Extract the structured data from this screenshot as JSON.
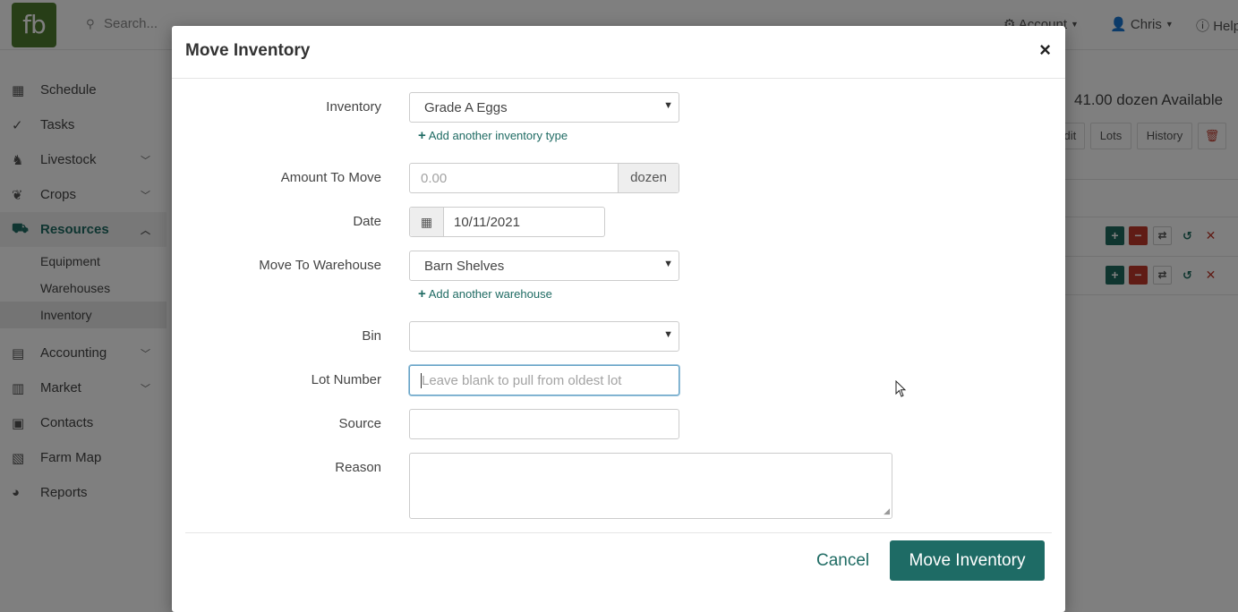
{
  "app": {
    "logo_text": "fb",
    "search_placeholder": "Search...",
    "account_label": "Account",
    "user_label": "Chris",
    "help_label": "Help"
  },
  "sidebar": {
    "items": [
      {
        "label": "Schedule",
        "icon": "calendar-icon"
      },
      {
        "label": "Tasks",
        "icon": "check-circle-icon"
      },
      {
        "label": "Livestock",
        "icon": "horse-icon"
      },
      {
        "label": "Crops",
        "icon": "seedling-icon"
      },
      {
        "label": "Resources",
        "icon": "tractor-icon"
      },
      {
        "label": "Accounting",
        "icon": "calculator-icon"
      },
      {
        "label": "Market",
        "icon": "store-icon"
      },
      {
        "label": "Contacts",
        "icon": "address-book-icon"
      },
      {
        "label": "Farm Map",
        "icon": "map-icon"
      },
      {
        "label": "Reports",
        "icon": "pie-chart-icon"
      }
    ],
    "resources_sub": [
      "Equipment",
      "Warehouses",
      "Inventory"
    ]
  },
  "background": {
    "available_text": "41.00 dozen Available",
    "buttons": [
      "Edit",
      "Lots",
      "History"
    ]
  },
  "modal": {
    "title": "Move Inventory",
    "close_glyph": "×",
    "fields": {
      "inventory_label": "Inventory",
      "inventory_value": "Grade A Eggs",
      "add_inventory_link": "Add another inventory type",
      "amount_label": "Amount To Move",
      "amount_placeholder": "0.00",
      "amount_unit": "dozen",
      "date_label": "Date",
      "date_value": "10/11/2021",
      "warehouse_label": "Move To Warehouse",
      "warehouse_value": "Barn Shelves",
      "add_warehouse_link": "Add another warehouse",
      "bin_label": "Bin",
      "bin_value": "",
      "lot_label": "Lot Number",
      "lot_placeholder": "Leave blank to pull from oldest lot",
      "source_label": "Source",
      "source_value": "",
      "reason_label": "Reason",
      "reason_value": ""
    },
    "cancel_label": "Cancel",
    "submit_label": "Move Inventory"
  }
}
